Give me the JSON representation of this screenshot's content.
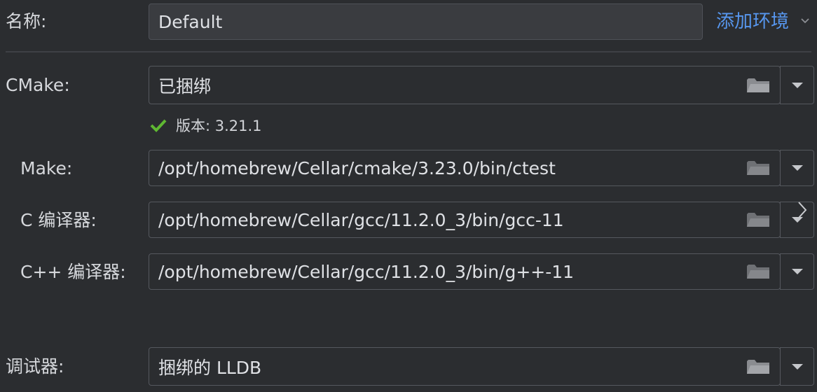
{
  "name": {
    "label": "名称:",
    "value": "Default",
    "add_env_link": "添加环境"
  },
  "cmake": {
    "label": "CMake:",
    "value": "已捆绑",
    "version_text": "版本: 3.21.1"
  },
  "make": {
    "label": "Make:",
    "value": "/opt/homebrew/Cellar/cmake/3.23.0/bin/ctest"
  },
  "c_compiler": {
    "label": "C 编译器:",
    "value": "/opt/homebrew/Cellar/gcc/11.2.0_3/bin/gcc-11"
  },
  "cpp_compiler": {
    "label": "C++ 编译器:",
    "value": "/opt/homebrew/Cellar/gcc/11.2.0_3/bin/g++-11"
  },
  "debugger": {
    "label": "调试器:",
    "value": "捆绑的 LLDB"
  },
  "colors": {
    "background": "#2b2d30",
    "link": "#5797ef",
    "check": "#5fb832",
    "border": "#55585e"
  },
  "icons": [
    "chevron-down-icon",
    "folder-icon",
    "dropdown-arrow-icon",
    "check-icon",
    "chevron-right-icon"
  ]
}
